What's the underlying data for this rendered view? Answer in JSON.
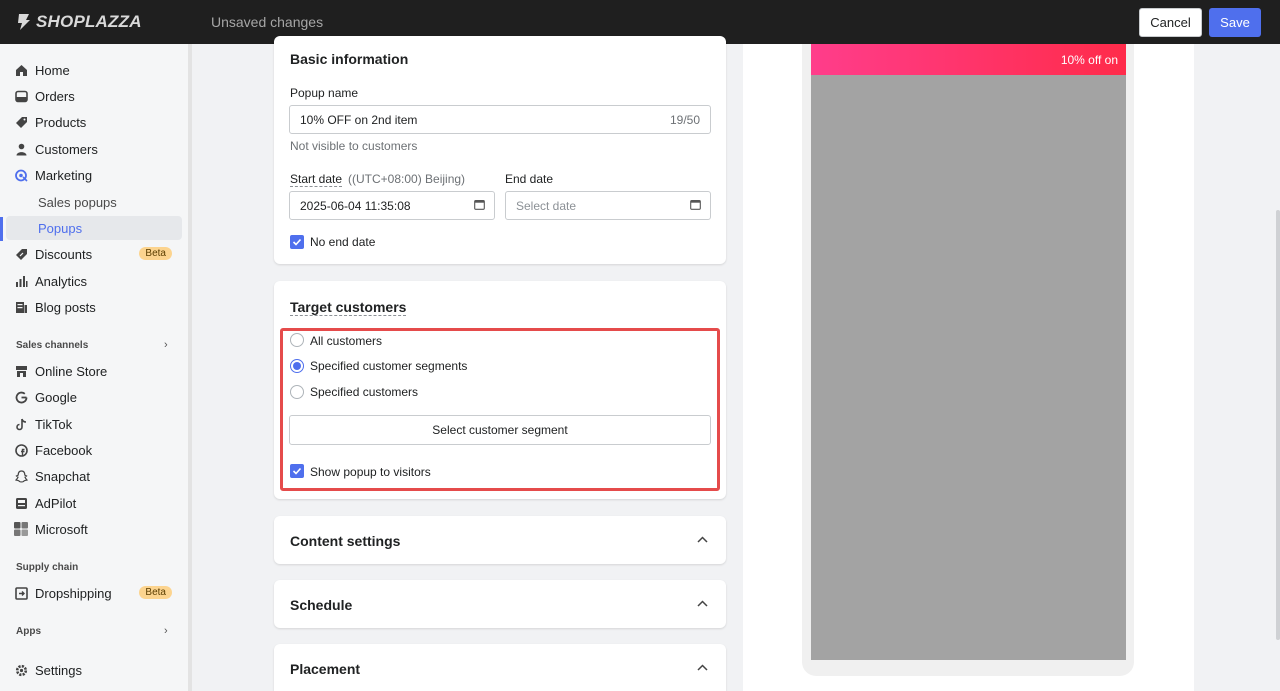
{
  "topbar": {
    "logo_text": "SHOPLAZZA",
    "status": "Unsaved changes",
    "cancel_label": "Cancel",
    "save_label": "Save"
  },
  "sidebar": {
    "items": [
      {
        "label": "Home",
        "icon": "home-icon"
      },
      {
        "label": "Orders",
        "icon": "orders-icon"
      },
      {
        "label": "Products",
        "icon": "tag-icon"
      },
      {
        "label": "Customers",
        "icon": "person-icon"
      },
      {
        "label": "Marketing",
        "icon": "marketing-icon"
      },
      {
        "label": "Sales popups"
      },
      {
        "label": "Popups"
      },
      {
        "label": "Discounts",
        "icon": "discount-icon",
        "badge": "Beta"
      },
      {
        "label": "Analytics",
        "icon": "bar-chart-icon"
      },
      {
        "label": "Blog posts",
        "icon": "blog-icon"
      }
    ],
    "sales_channels_label": "Sales channels",
    "channels": [
      {
        "label": "Online Store",
        "icon": "store-icon"
      },
      {
        "label": "Google",
        "icon": "google-icon"
      },
      {
        "label": "TikTok",
        "icon": "tiktok-icon"
      },
      {
        "label": "Facebook",
        "icon": "facebook-icon"
      },
      {
        "label": "Snapchat",
        "icon": "snapchat-icon"
      },
      {
        "label": "AdPilot",
        "icon": "adpilot-icon"
      },
      {
        "label": "Microsoft",
        "icon": "microsoft-icon"
      }
    ],
    "supply_chain_label": "Supply chain",
    "supply": [
      {
        "label": "Dropshipping",
        "icon": "dropshipping-icon",
        "badge": "Beta"
      }
    ],
    "apps_label": "Apps",
    "settings_label": "Settings"
  },
  "basic_info": {
    "title": "Basic information",
    "popup_name_label": "Popup name",
    "popup_name_value": "10% OFF on 2nd item",
    "popup_name_count": "19/50",
    "popup_name_hint": "Not visible to customers",
    "start_date_label": "Start date",
    "start_date_tz": "((UTC+08:00) Beijing)",
    "start_date_value": "2025-06-04 11:35:08",
    "end_date_label": "End date",
    "end_date_placeholder": "Select date",
    "no_end_date_label": "No end date"
  },
  "target": {
    "title": "Target customers",
    "options": [
      "All customers",
      "Specified customer segments",
      "Specified customers"
    ],
    "selected_index": 1,
    "select_segment_label": "Select customer segment",
    "show_visitors_label": "Show popup to visitors"
  },
  "sections": {
    "content": "Content settings",
    "schedule": "Schedule",
    "placement": "Placement"
  },
  "preview": {
    "banner_text": "10% off on"
  },
  "colors": {
    "accent": "#4f6fed",
    "highlight": "#e54b4b",
    "topbar": "#1f1f1f"
  }
}
